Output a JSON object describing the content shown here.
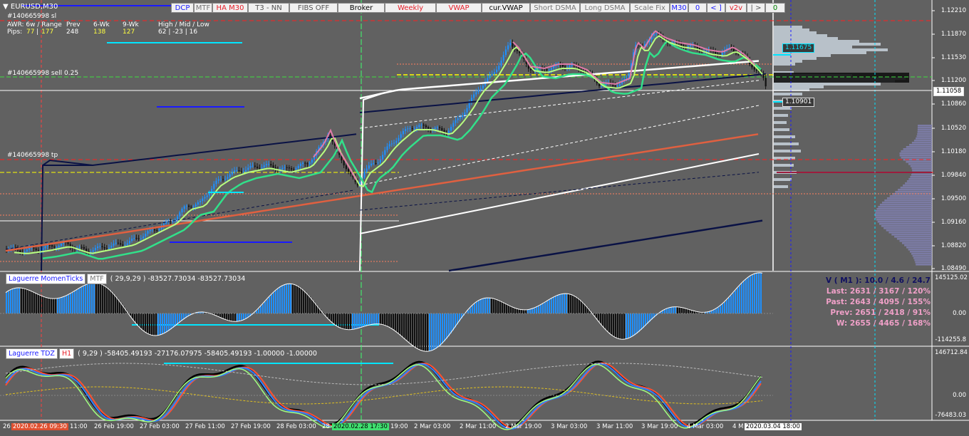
{
  "window": {
    "title": "EURUSD,M30"
  },
  "info": {
    "order_sl": "#140665998 sl",
    "awr_label": "AWR: 6w / Range",
    "prev_label": "Prev",
    "wk6_label": "6-Wk",
    "wk9_label": "9-Wk",
    "hml_label": "High / Mid / Low",
    "pips_label": "Pips:",
    "awr_a": "77",
    "awr_sep": "|",
    "awr_b": "177",
    "prev_val": "248",
    "wk6_val": "138",
    "wk9_val": "127",
    "hml_val": "62  |  -23  |  16",
    "sell_label": "#140665998 sell 0.25",
    "tp_label": "#140665998 tp"
  },
  "toolbar": [
    {
      "label": "DCP",
      "color": "#1a1aff"
    },
    {
      "label": "MTF",
      "color": "#777777"
    },
    {
      "label": "HA M30",
      "color": "#e8202a"
    },
    {
      "label": "T3 - NN",
      "color": "#555555"
    },
    {
      "label": "FIBS OFF",
      "color": "#555555"
    },
    {
      "label": "Broker",
      "color": "#000000"
    },
    {
      "label": "Weekly",
      "color": "#e8202a"
    },
    {
      "label": "VWAP",
      "color": "#e8202a"
    },
    {
      "label": "cur.VWAP",
      "color": "#000000"
    },
    {
      "label": "Short DSMA",
      "color": "#777777"
    },
    {
      "label": "Long DSMA",
      "color": "#777777"
    },
    {
      "label": "Scale Fix",
      "color": "#777777"
    },
    {
      "label": "M30",
      "color": "#1a1aff"
    },
    {
      "label": "0",
      "color": "#1a1aff"
    },
    {
      "label": "< ]",
      "color": "#1a1aff"
    },
    {
      "label": "v2v",
      "color": "#e8202a"
    },
    {
      "label": "| >",
      "color": "#555555"
    },
    {
      "label": "0",
      "color": "#008000"
    }
  ],
  "price_axis": [
    "1.12210",
    "1.11870",
    "1.11530",
    "1.11200",
    "1.10860",
    "1.10520",
    "1.10180",
    "1.09840",
    "1.09500",
    "1.09160",
    "1.08820",
    "1.08490"
  ],
  "price_boxes": {
    "current": "1.11058",
    "upper": "1.11675",
    "lower": "1.10901"
  },
  "momentum": {
    "name": "Laguerre MomenTicks",
    "mtf": "MTF",
    "params": "( 29,9,29 ) -83527.73034 -83527.73034",
    "axis": [
      "145125.02",
      "0.00",
      "-114255.8"
    ]
  },
  "vstats": {
    "v": "V ( M1 ): 10.0 / 4.6 / 24.7",
    "last": "Last: 2631 / 3167 / 120%",
    "past": "Past: 2643 / 4095 / 155%",
    "prev": "Prev: 2651 / 2418 / 91%",
    "w": "W: 2655 / 4465 / 168%"
  },
  "tdz": {
    "name": "Laguerre TDZ",
    "tf": "H1",
    "params": "( 9,29 ) -58405.49193 -27176.07975 -58405.49193 -1.00000 -1.00000",
    "axis": [
      "146712.84",
      "0.00",
      "-76483.03"
    ]
  },
  "time_axis": {
    "labels": [
      "26",
      "11:00",
      "26 Feb 19:00",
      "27 Feb 03:00",
      "27 Feb 11:00",
      "27 Feb 19:00",
      "28 Feb 03:00",
      "28",
      "19:00",
      "2 Mar 03:00",
      "2 Mar 11:00",
      "2 Mar 19:00",
      "3 Mar 03:00",
      "3 Mar 11:00",
      "3 Mar 19:00",
      "4 Mar 03:00",
      "4 M"
    ],
    "marker_red": "2020.02.26 09:30",
    "marker_green": "2020.02.28 17:30",
    "marker_end": "2020.03.04 18:00"
  },
  "colors": {
    "bg": "#616161",
    "axis_bg": "#5c5c5c",
    "up_candle": "#1e90ff",
    "down_candle": "#111111",
    "vwap_red": "#e06040",
    "band_white": "#ffffff",
    "band_navy": "#0a1245",
    "ma_green": "#32e08a",
    "ma_lime": "#b8ff80",
    "ma_pink": "#e07aa8",
    "hist_blue": "#1e90ff",
    "hist_black": "#111111",
    "level_cyan": "#00e5ff",
    "level_blue": "#1a1aff",
    "level_yellow": "#ffff00",
    "level_red": "#ff2020",
    "stat_pink": "#f0a0c8",
    "stat_navy": "#101060"
  }
}
